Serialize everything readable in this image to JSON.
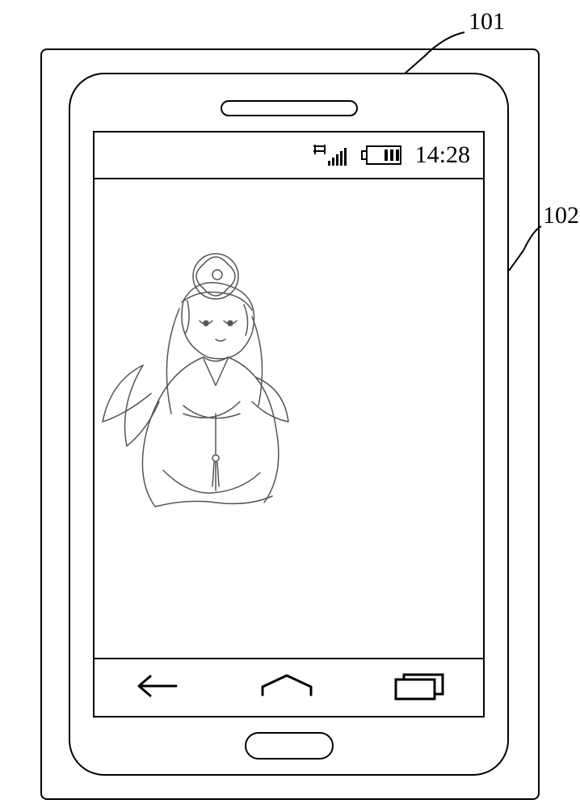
{
  "callouts": {
    "c101": "101",
    "c102": "102"
  },
  "status_bar": {
    "time": "14:28",
    "signal_icon": "signal",
    "battery_icon": "battery"
  },
  "nav": {
    "back": "back",
    "home": "home",
    "recent": "recent"
  },
  "content": {
    "illustration": "anime-girl-lineart"
  }
}
